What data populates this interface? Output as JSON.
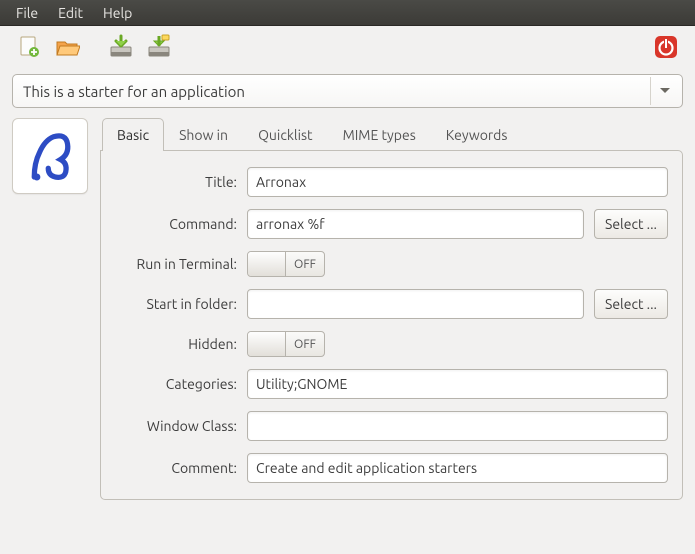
{
  "menubar": {
    "file": "File",
    "edit": "Edit",
    "help": "Help"
  },
  "combo": {
    "text": "This is a starter for an application"
  },
  "tabs": {
    "basic": "Basic",
    "showin": "Show in",
    "quicklist": "Quicklist",
    "mimetypes": "MIME types",
    "keywords": "Keywords"
  },
  "form": {
    "title_label": "Title:",
    "title_value": "Arronax",
    "command_label": "Command:",
    "command_value": "arronax %f",
    "select_label": "Select ...",
    "runterm_label": "Run in Terminal:",
    "startfolder_label": "Start in folder:",
    "startfolder_value": "",
    "hidden_label": "Hidden:",
    "categories_label": "Categories:",
    "categories_value": "Utility;GNOME",
    "winclass_label": "Window Class:",
    "winclass_value": "",
    "comment_label": "Comment:",
    "comment_value": "Create and edit application starters",
    "toggle_off": "OFF"
  }
}
